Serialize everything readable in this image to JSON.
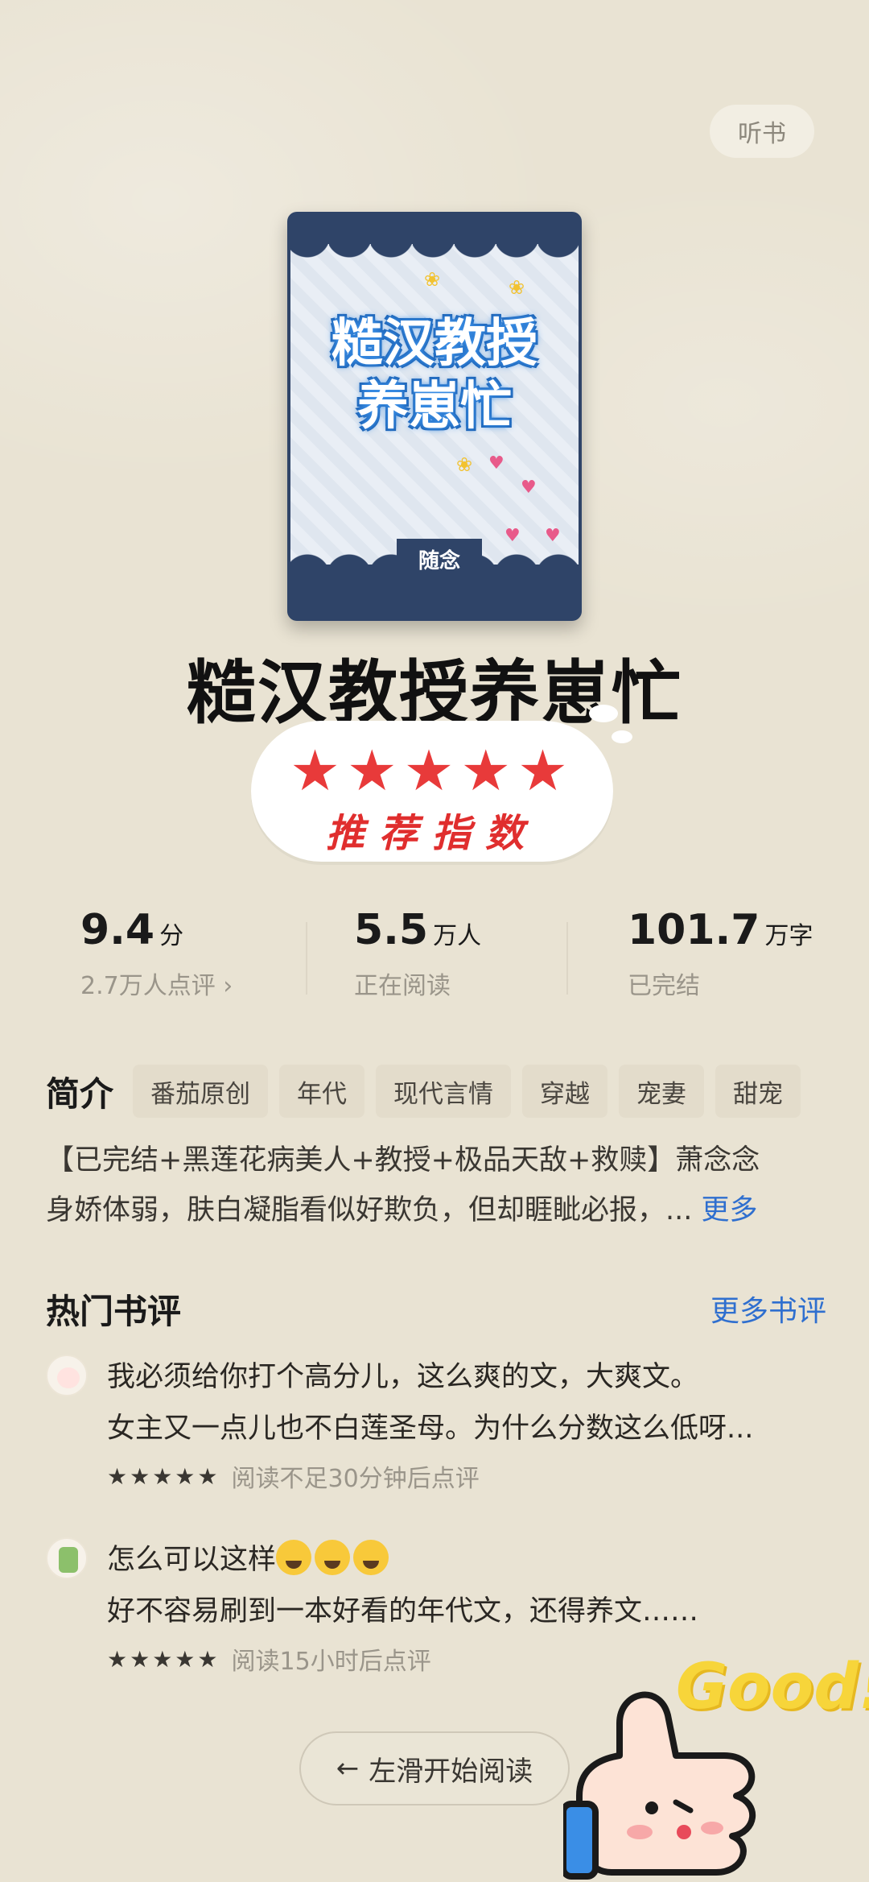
{
  "header": {
    "listen_label": "听书"
  },
  "book": {
    "cover_title_line1": "糙汉教授",
    "cover_title_line2": "养崽忙",
    "cover_author": "随念",
    "title": "糙汉教授养崽忙"
  },
  "badge": {
    "stars": "★★★★★",
    "text": "推荐指数"
  },
  "stats": [
    {
      "value": "9.4",
      "unit": "分",
      "sub": "2.7万人点评 ›"
    },
    {
      "value": "5.5",
      "unit": "万人",
      "sub": "正在阅读"
    },
    {
      "value": "101.7",
      "unit": "万字",
      "sub": "已完结"
    }
  ],
  "intro": {
    "label": "简介",
    "tags": [
      "番茄原创",
      "年代",
      "现代言情",
      "穿越",
      "宠妻",
      "甜宠"
    ],
    "line1": "【已完结+黑莲花病美人+教授+极品天敌+救赎】萧念念",
    "line2": "身娇体弱，肤白凝脂看似好欺负，但却睚眦必报，...",
    "more": "更多"
  },
  "reviews_section": {
    "title": "热门书评",
    "more": "更多书评"
  },
  "reviews": [
    {
      "line1": "我必须给你打个高分儿，这么爽的文，大爽文。",
      "line2": "女主又一点儿也不白莲圣母。为什么分数这么低呀...",
      "stars": "★★★★★",
      "note": "阅读不足30分钟后点评"
    },
    {
      "line1": "怎么可以这样",
      "line2": "好不容易刷到一本好看的年代文，还得养文……",
      "stars": "★★★★★",
      "note": "阅读15小时后点评"
    }
  ],
  "start_button": {
    "arrow": "←",
    "label": "左滑开始阅读"
  },
  "sticker": {
    "text": "Good!"
  }
}
